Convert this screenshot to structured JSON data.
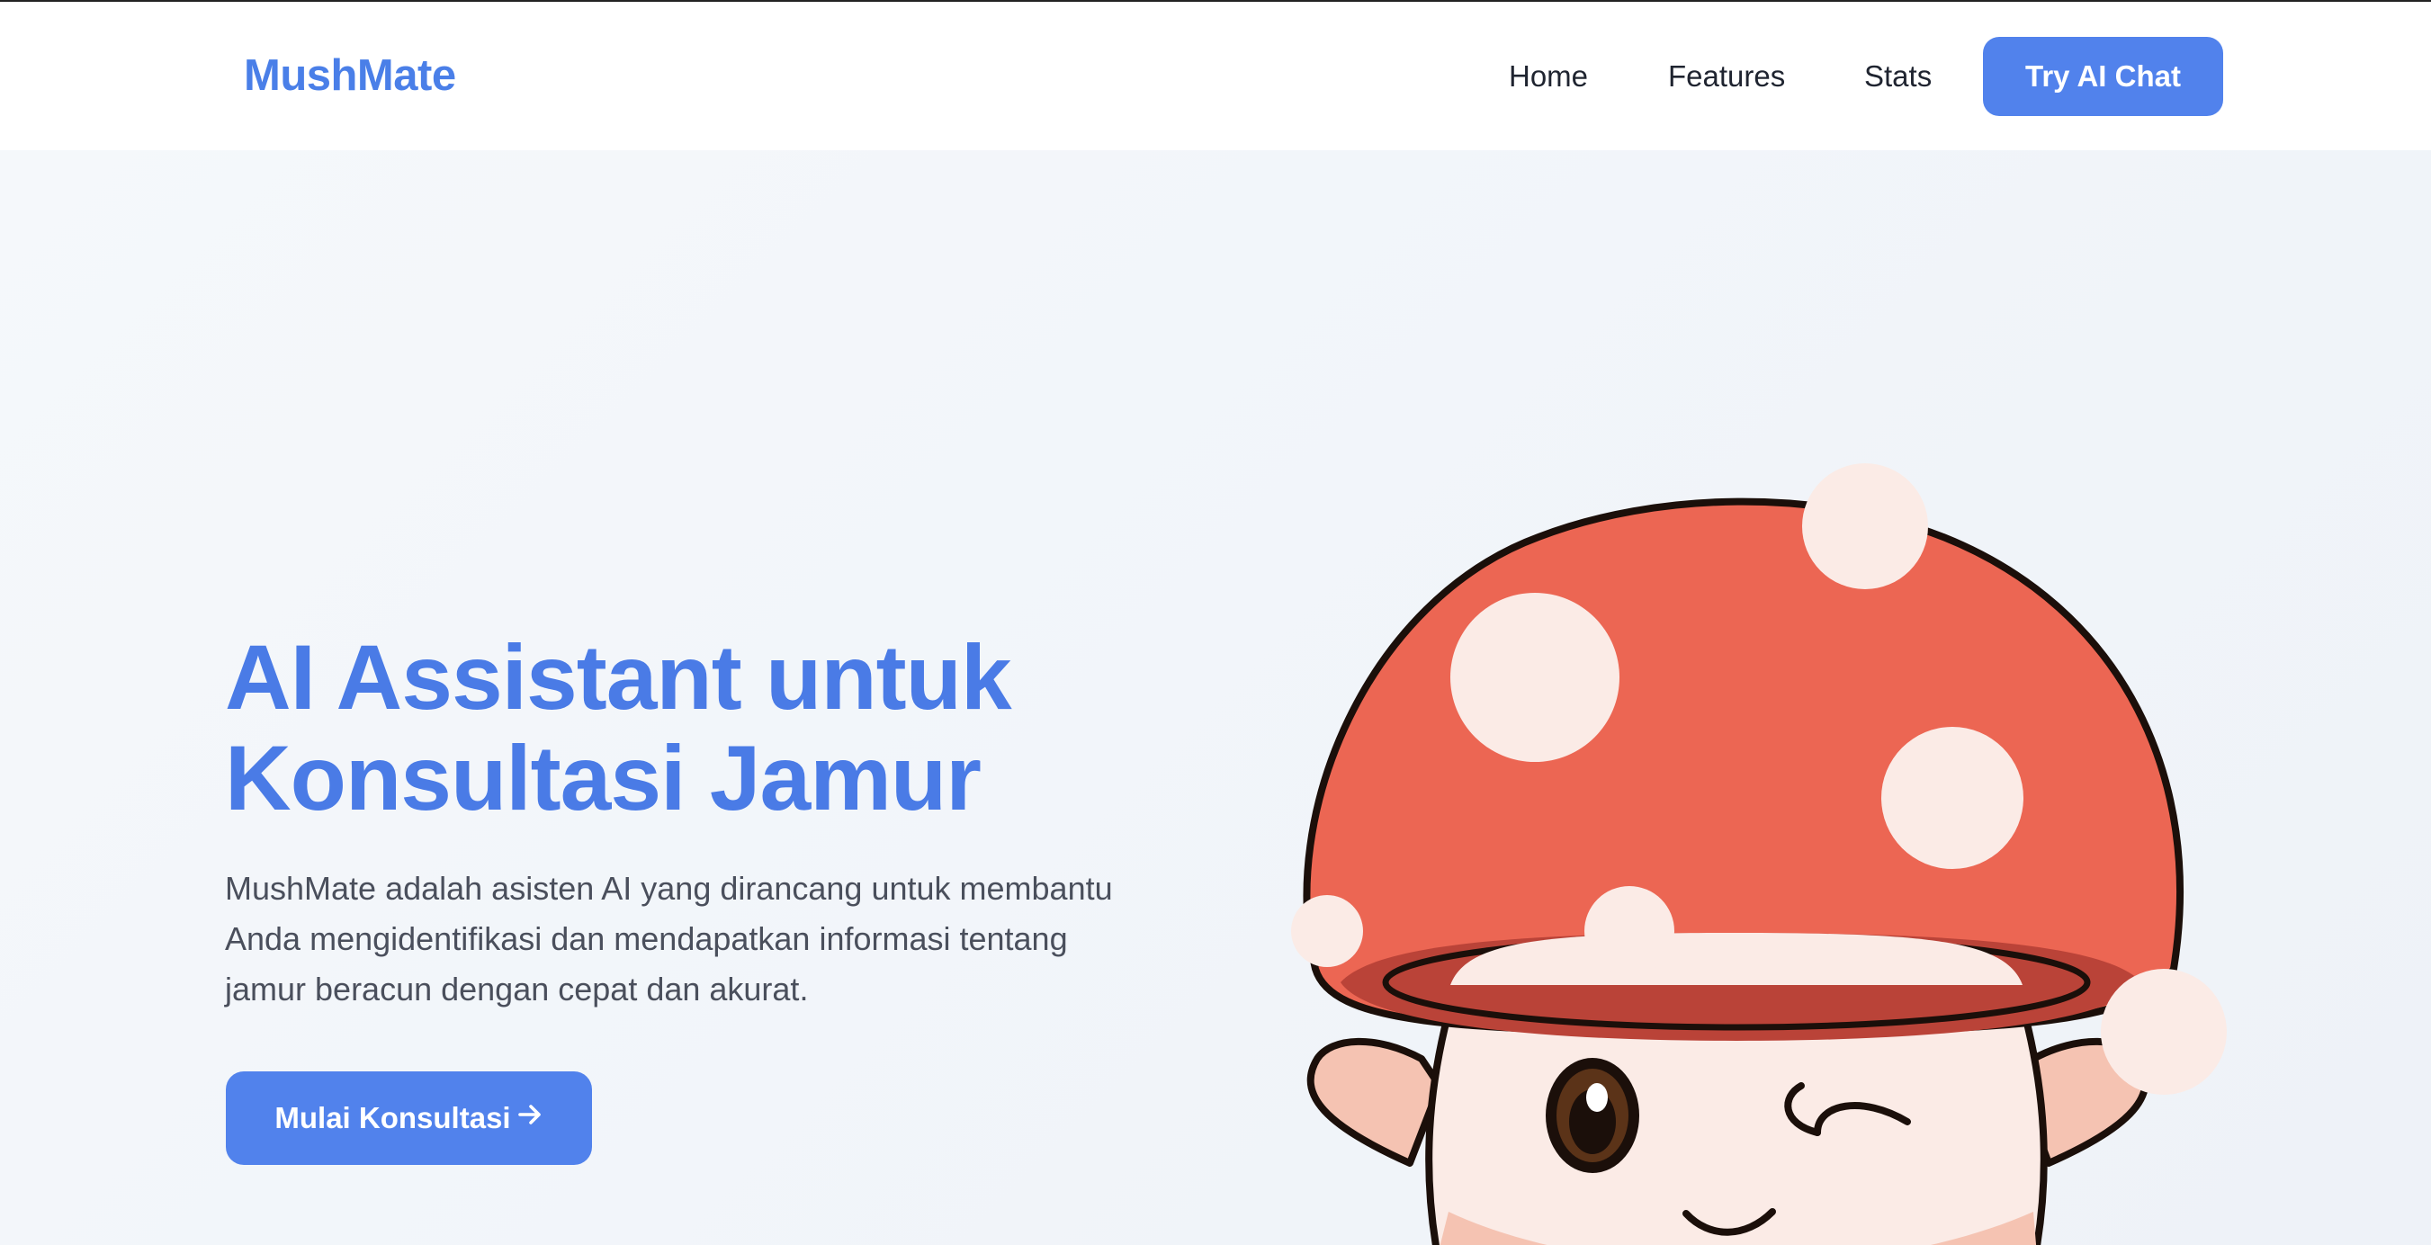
{
  "nav": {
    "logo": "MushMate",
    "links": [
      "Home",
      "Features",
      "Stats"
    ],
    "cta": "Try AI Chat"
  },
  "hero": {
    "title_lines": [
      "AI Assistant untuk",
      "Konsultasi Jamur"
    ],
    "description_lines": [
      "MushMate adalah asisten AI yang dirancang untuk membantu",
      "Anda mengidentifikasi dan mendapatkan informasi tentang",
      "jamur beracun dengan cepat dan akurat."
    ],
    "cta": "Mulai Konsultasi",
    "cta_icon": "arrow-right-icon"
  },
  "colors": {
    "brand": "#4a7be6",
    "button": "#5182ec",
    "mushroom_cap": "#ec6653",
    "mushroom_spots": "#fbebe6",
    "mushroom_face": "#fbebe6"
  }
}
